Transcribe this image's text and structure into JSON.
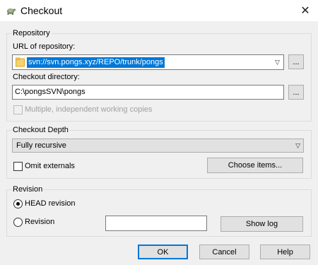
{
  "window": {
    "title": "Checkout",
    "close_glyph": "✕"
  },
  "repository": {
    "group_label": "Repository",
    "url_label": "URL of repository:",
    "url_value": "svn://svn.pongs.xyz/REPO/trunk/pongs",
    "browse_label": "...",
    "dir_label": "Checkout directory:",
    "dir_value": "C:\\pongsSVN\\pongs",
    "dir_browse_label": "...",
    "multiple_wc_label": "Multiple, independent working copies"
  },
  "depth": {
    "group_label": "Checkout Depth",
    "selected": "Fully recursive",
    "omit_externals_label": "Omit externals",
    "choose_items_label": "Choose items..."
  },
  "revision": {
    "group_label": "Revision",
    "head_label": "HEAD revision",
    "revision_label": "Revision",
    "revision_value": "",
    "show_log_label": "Show log"
  },
  "buttons": {
    "ok": "OK",
    "cancel": "Cancel",
    "help": "Help"
  },
  "colors": {
    "selection": "#0078d7",
    "default_button_border": "#0078d7"
  },
  "icons": {
    "title": "tortoise-icon",
    "close": "close-icon",
    "url": "folder-icon"
  }
}
